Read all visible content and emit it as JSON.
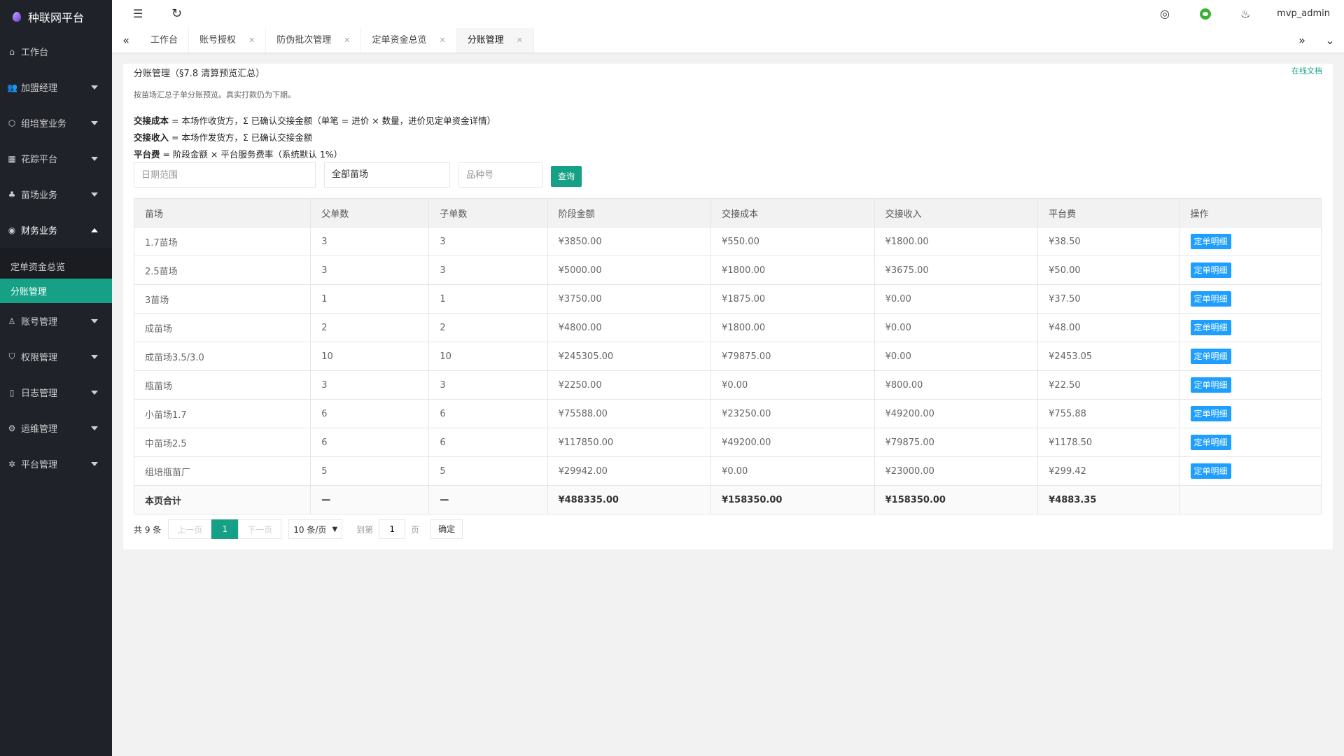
{
  "app": {
    "title": "种联网平台"
  },
  "sidebar": {
    "items": [
      {
        "label": "工作台",
        "icon": "home-icon",
        "glyph": "⌂",
        "has_caret": false
      },
      {
        "label": "加盟经理",
        "icon": "users-icon",
        "glyph": "👥",
        "has_caret": true
      },
      {
        "label": "组培室业务",
        "icon": "shield-icon",
        "glyph": "⬡",
        "has_caret": true
      },
      {
        "label": "花踪平台",
        "icon": "grid-icon",
        "glyph": "▦",
        "has_caret": true
      },
      {
        "label": "苗场业务",
        "icon": "sprout-icon",
        "glyph": "♣",
        "has_caret": true
      },
      {
        "label": "财务业务",
        "icon": "finance-icon",
        "glyph": "◉",
        "has_caret": true,
        "open": true
      },
      {
        "label": "账号管理",
        "icon": "user-icon",
        "glyph": "♙",
        "has_caret": true
      },
      {
        "label": "权限管理",
        "icon": "shield-check-icon",
        "glyph": "⛉",
        "has_caret": true
      },
      {
        "label": "日志管理",
        "icon": "file-icon",
        "glyph": "▯",
        "has_caret": true
      },
      {
        "label": "运维管理",
        "icon": "wrench-icon",
        "glyph": "⚙",
        "has_caret": true
      },
      {
        "label": "平台管理",
        "icon": "gear-icon",
        "glyph": "✲",
        "has_caret": true
      }
    ],
    "finance_sub": [
      {
        "label": "定单资金总览",
        "active": false
      },
      {
        "label": "分账管理",
        "active": true
      }
    ]
  },
  "header": {
    "menu_toggle_glyph": "☰",
    "refresh_glyph": "↻",
    "globe_glyph": "◎",
    "shirt_glyph": "♨",
    "user": "mvp_admin"
  },
  "tabs": {
    "prev_glyph": "«",
    "next_glyph": "»",
    "more_glyph": "⌄",
    "close_glyph": "✕",
    "items": [
      {
        "label": "工作台",
        "closable": false,
        "active": false
      },
      {
        "label": "账号授权",
        "closable": true,
        "active": false
      },
      {
        "label": "防伪批次管理",
        "closable": true,
        "active": false
      },
      {
        "label": "定单资金总览",
        "closable": true,
        "active": false
      },
      {
        "label": "分账管理",
        "closable": true,
        "active": true
      }
    ]
  },
  "main": {
    "title": "分账管理（§7.8 清算预览汇总）",
    "doc_link": "在线文档",
    "desc": "按苗场汇总子单分账预览。真实打款仍为下期。",
    "formulas": [
      {
        "term": "交接成本",
        "text": " = 本场作收货方，Σ 已确认交接金额（单笔 = 进价 × 数量，进价见定单资金详情）"
      },
      {
        "term": "交接收入",
        "text": " = 本场作发货方，Σ 已确认交接金额"
      },
      {
        "term": "平台费",
        "text": " = 阶段金额 × 平台服务费率（系统默认 1%）"
      }
    ],
    "filters": {
      "date_placeholder": "日期范围",
      "farm_select": "全部苗场",
      "variety_placeholder": "品种号",
      "query_label": "查询"
    },
    "table": {
      "headers": [
        "苗场",
        "父单数",
        "子单数",
        "阶段金额",
        "交接成本",
        "交接收入",
        "平台费",
        "操作"
      ],
      "action_label": "定单明细",
      "rows": [
        [
          "1.7苗场",
          "3",
          "3",
          "¥3850.00",
          "¥550.00",
          "¥1800.00",
          "¥38.50"
        ],
        [
          "2.5苗场",
          "3",
          "3",
          "¥5000.00",
          "¥1800.00",
          "¥3675.00",
          "¥50.00"
        ],
        [
          "3苗场",
          "1",
          "1",
          "¥3750.00",
          "¥1875.00",
          "¥0.00",
          "¥37.50"
        ],
        [
          "成苗场",
          "2",
          "2",
          "¥4800.00",
          "¥1800.00",
          "¥0.00",
          "¥48.00"
        ],
        [
          "成苗场3.5/3.0",
          "10",
          "10",
          "¥245305.00",
          "¥79875.00",
          "¥0.00",
          "¥2453.05"
        ],
        [
          "瓶苗场",
          "3",
          "3",
          "¥2250.00",
          "¥0.00",
          "¥800.00",
          "¥22.50"
        ],
        [
          "小苗场1.7",
          "6",
          "6",
          "¥75588.00",
          "¥23250.00",
          "¥49200.00",
          "¥755.88"
        ],
        [
          "中苗场2.5",
          "6",
          "6",
          "¥117850.00",
          "¥49200.00",
          "¥79875.00",
          "¥1178.50"
        ],
        [
          "组培瓶苗厂",
          "5",
          "5",
          "¥29942.00",
          "¥0.00",
          "¥23000.00",
          "¥299.42"
        ]
      ],
      "total": [
        "本页合计",
        "—",
        "—",
        "¥488335.00",
        "¥158350.00",
        "¥158350.00",
        "¥4883.35",
        ""
      ]
    },
    "pager": {
      "count": "共 9 条",
      "prev": "上一页",
      "current": "1",
      "next": "下一页",
      "page_size": "10 条/页",
      "goto_label": "到第",
      "goto_value": "1",
      "page_unit": "页",
      "confirm": "确定"
    }
  },
  "colors": {
    "accent": "#16a085",
    "action_blue": "#1e9fff",
    "sidebar_bg": "#20222a"
  }
}
